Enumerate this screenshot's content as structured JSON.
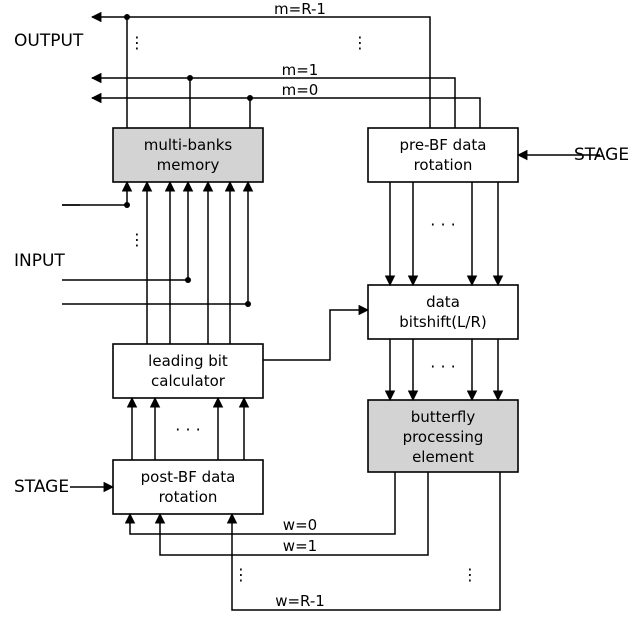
{
  "labels": {
    "output": "OUTPUT",
    "input": "INPUT",
    "stage_left": "STAGE",
    "stage_right": "STAGE",
    "m_top": "m=R-1",
    "m_1": "m=1",
    "m_0": "m=0",
    "w_0": "w=0",
    "w_1": "w=1",
    "w_bot": "w=R-1"
  },
  "blocks": {
    "mem_l1": "multi-banks",
    "mem_l2": "memory",
    "pre_l1": "pre-BF data",
    "pre_l2": "rotation",
    "shift_l1": "data",
    "shift_l2": "bitshift(L/R)",
    "lead_l1": "leading bit",
    "lead_l2": "calculator",
    "bfly_l1": "butterfly",
    "bfly_l2": "processing",
    "bfly_l3": "element",
    "post_l1": "post-BF data",
    "post_l2": "rotation"
  }
}
